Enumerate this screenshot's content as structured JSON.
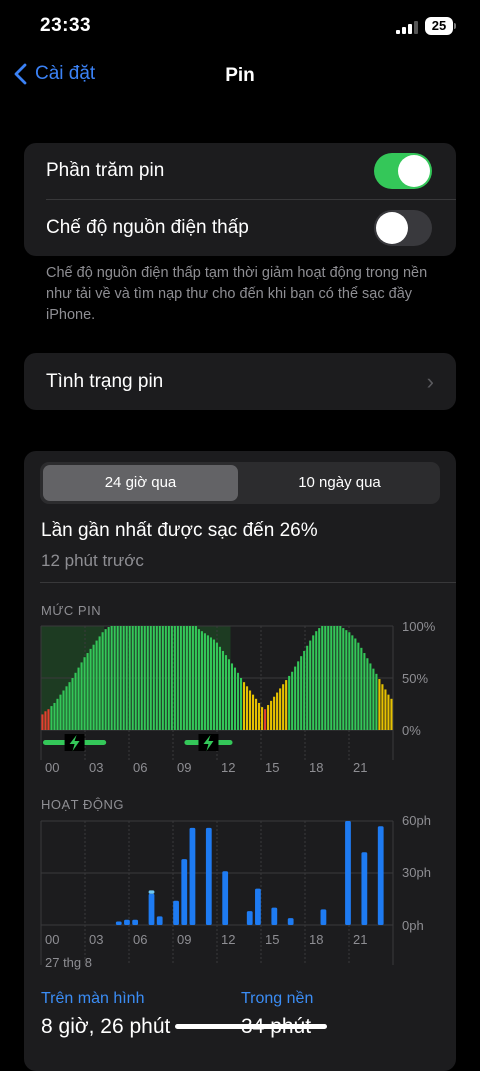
{
  "status_bar": {
    "time": "23:33",
    "battery": "25"
  },
  "nav": {
    "back_label": "Cài đặt",
    "title": "Pin"
  },
  "toggles": {
    "battery_percent_label": "Phần trăm pin",
    "battery_percent_on": true,
    "low_power_label": "Chế độ nguồn điện thấp",
    "low_power_on": false
  },
  "footnote": "Chế độ nguồn điện thấp tạm thời giảm hoạt động trong nền như tải về và tìm nạp thư cho đến khi bạn có thể sạc đầy iPhone.",
  "battery_health_label": "Tình trạng pin",
  "segments": [
    "24 giờ qua",
    "10 ngày qua"
  ],
  "last_charge": {
    "title": "Lần gần nhất được sạc đến 26%",
    "ago": "12 phút trước"
  },
  "battery_level": {
    "section_label": "MỨC PIN",
    "y_labels": [
      "100%",
      "50%",
      "0%"
    ],
    "x_labels": [
      "00",
      "03",
      "06",
      "09",
      "12",
      "15",
      "18",
      "21"
    ]
  },
  "activity": {
    "section_label": "HOẠT ĐỘNG",
    "y_labels": [
      "60ph",
      "30ph",
      "0ph"
    ],
    "x_labels": [
      "00",
      "03",
      "06",
      "09",
      "12",
      "15",
      "18",
      "21"
    ],
    "date_label": "27 thg 8"
  },
  "usage": {
    "screen_on_label": "Trên màn hình",
    "screen_on_value": "8 giờ, 26 phút",
    "background_label": "Trong nền",
    "background_value": "34 phút"
  },
  "colors": {
    "accent": "#3b82f6",
    "green": "#34c759",
    "yellow": "#e6c200",
    "red": "#e5402f",
    "bar_blue": "#1e7bf2"
  },
  "chart_data": [
    {
      "type": "bar",
      "title": "MỨC PIN",
      "x_tick_labels": [
        "00",
        "03",
        "06",
        "09",
        "12",
        "15",
        "18",
        "21"
      ],
      "ylim": [
        0,
        100
      ],
      "unit": "%",
      "values": [
        15,
        18,
        20,
        23,
        26,
        30,
        34,
        38,
        42,
        46,
        50,
        55,
        60,
        65,
        70,
        74,
        78,
        82,
        86,
        90,
        94,
        97,
        99,
        100,
        100,
        100,
        100,
        100,
        100,
        100,
        100,
        100,
        100,
        100,
        100,
        100,
        100,
        100,
        100,
        100,
        100,
        100,
        100,
        100,
        100,
        100,
        100,
        100,
        100,
        100,
        100,
        100,
        97,
        95,
        93,
        91,
        89,
        87,
        84,
        80,
        76,
        72,
        68,
        64,
        60,
        55,
        50,
        46,
        42,
        38,
        34,
        30,
        26,
        22,
        20,
        24,
        28,
        32,
        36,
        40,
        44,
        48,
        52,
        56,
        61,
        66,
        71,
        76,
        81,
        86,
        91,
        95,
        98,
        100,
        100,
        100,
        100,
        100,
        100,
        100,
        98,
        96,
        94,
        91,
        88,
        84,
        79,
        74,
        69,
        64,
        59,
        54,
        49,
        44,
        39,
        34,
        30
      ],
      "charging_ranges": [
        [
          0,
          20
        ],
        [
          47,
          62
        ]
      ]
    },
    {
      "type": "bar",
      "title": "HOẠT ĐỘNG",
      "x_tick_labels": [
        "00",
        "03",
        "06",
        "09",
        "12",
        "15",
        "18",
        "21"
      ],
      "ylim": [
        0,
        60
      ],
      "unit": "ph",
      "series": [
        {
          "name": "Trên màn hình",
          "values": [
            0,
            0,
            0,
            0,
            0,
            0,
            0,
            0,
            0,
            2,
            3,
            3,
            0,
            18,
            5,
            0,
            14,
            38,
            56,
            0,
            56,
            0,
            31,
            0,
            0,
            8,
            21,
            0,
            10,
            0,
            4,
            0,
            0,
            0,
            9,
            0,
            0,
            60,
            0,
            42,
            0,
            57,
            0
          ]
        },
        {
          "name": "Trong nền",
          "values": [
            0,
            0,
            0,
            0,
            0,
            0,
            0,
            0,
            0,
            0,
            0,
            0,
            0,
            2,
            0,
            0,
            0,
            0,
            0,
            0,
            0,
            0,
            0,
            0,
            0,
            0,
            0,
            0,
            0,
            0,
            0,
            0,
            0,
            0,
            0,
            0,
            0,
            0,
            0,
            0,
            0,
            0,
            0
          ]
        }
      ]
    }
  ]
}
